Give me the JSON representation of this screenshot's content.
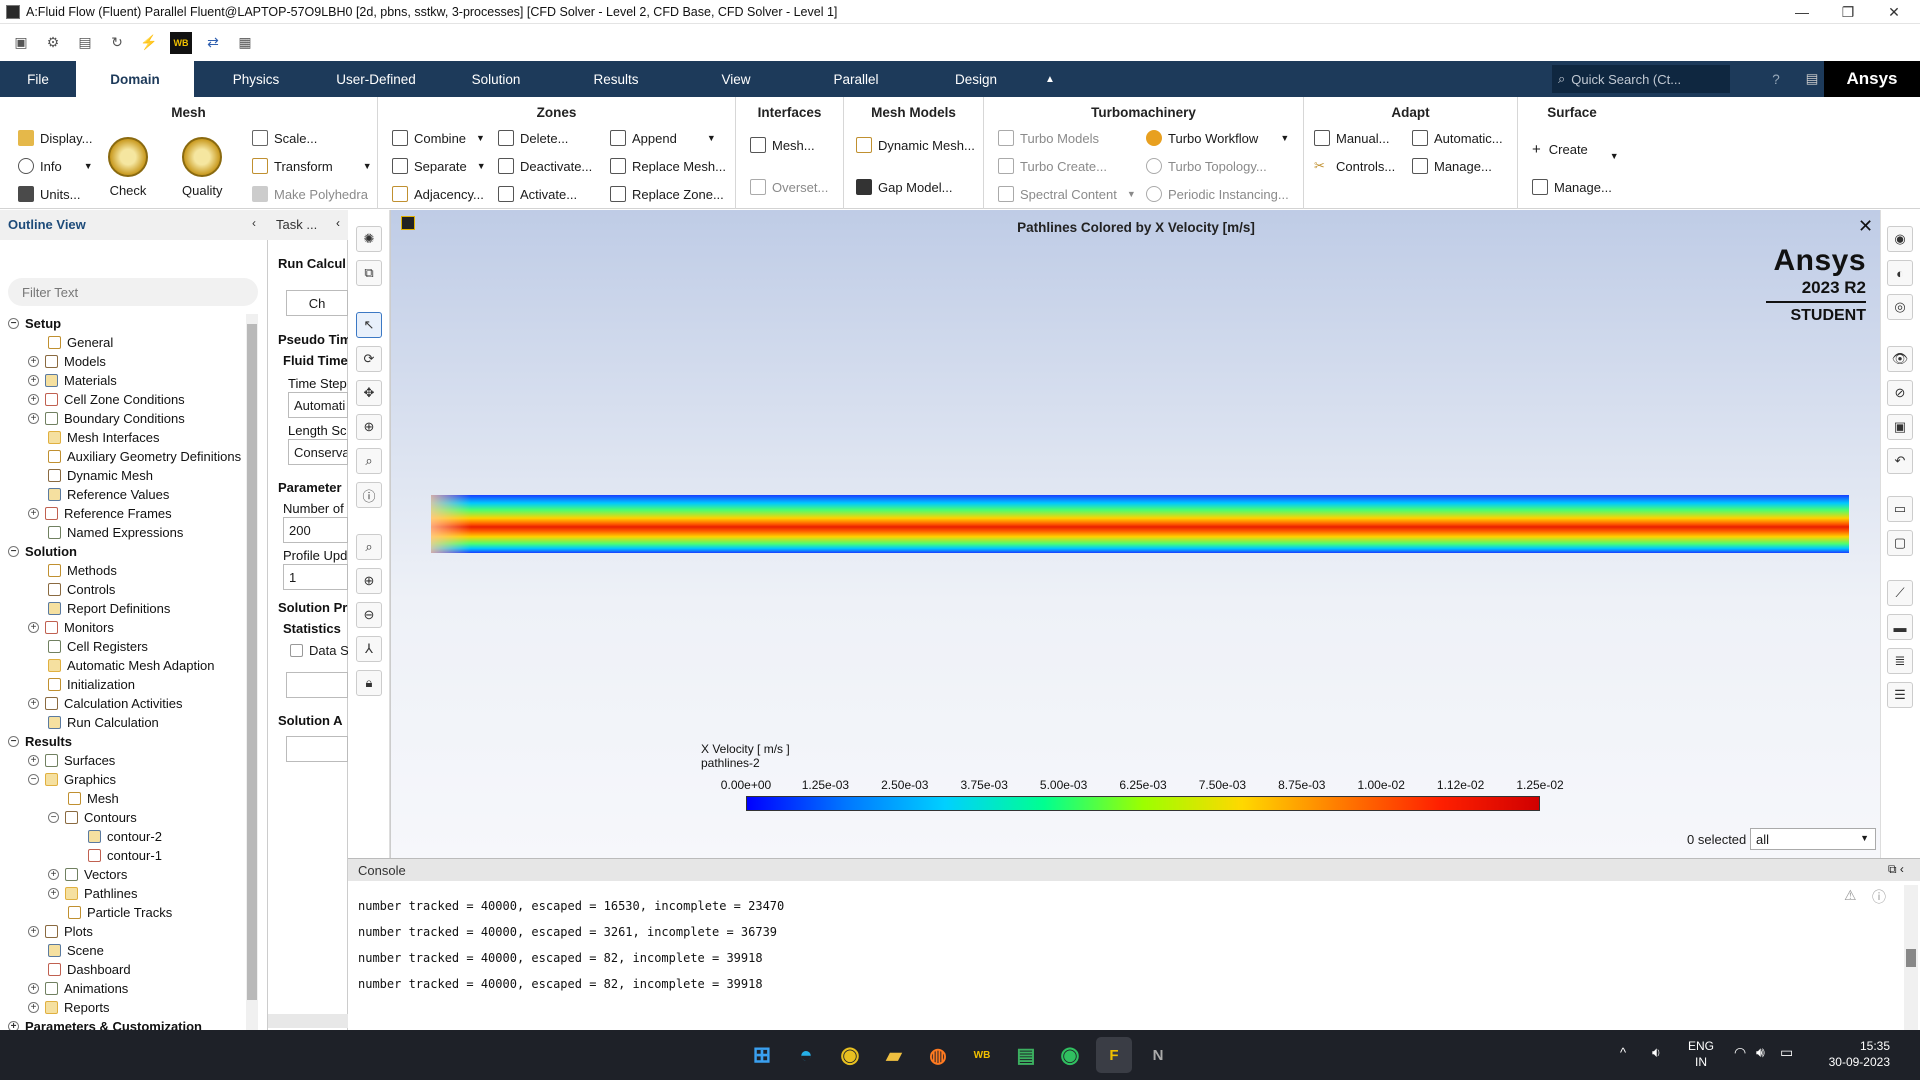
{
  "window": {
    "title": "A:Fluid Flow (Fluent) Parallel Fluent@LAPTOP-57O9LBH0  [2d, pbns, sstkw, 3-processes] [CFD Solver - Level 2, CFD Base, CFD Solver - Level 1]"
  },
  "quick_access": {
    "wb_label": "WB"
  },
  "tabs": [
    "File",
    "Domain",
    "Physics",
    "User-Defined",
    "Solution",
    "Results",
    "View",
    "Parallel",
    "Design"
  ],
  "active_tab": "Domain",
  "search": {
    "placeholder": "Quick Search (Ct..."
  },
  "brand_tab": "Ansys",
  "ribbon": {
    "mesh": {
      "title": "Mesh",
      "display": "Display...",
      "info": "Info",
      "units": "Units...",
      "check": "Check",
      "quality": "Quality",
      "scale": "Scale...",
      "transform": "Transform",
      "make_polyhedra": "Make Polyhedra"
    },
    "zones": {
      "title": "Zones",
      "combine": "Combine",
      "separate": "Separate",
      "adjacency": "Adjacency...",
      "delete": "Delete...",
      "deactivate": "Deactivate...",
      "activate": "Activate...",
      "append": "Append",
      "replace_mesh": "Replace Mesh...",
      "replace_zone": "Replace Zone..."
    },
    "interfaces": {
      "title": "Interfaces",
      "mesh": "Mesh...",
      "overset": "Overset..."
    },
    "mesh_models": {
      "title": "Mesh Models",
      "dynamic_mesh": "Dynamic Mesh...",
      "gap_model": "Gap Model..."
    },
    "turbomachinery": {
      "title": "Turbomachinery",
      "turbo_models": "Turbo Models",
      "turbo_create": "Turbo Create...",
      "spectral_content": "Spectral Content",
      "turbo_workflow": "Turbo Workflow",
      "turbo_topology": "Turbo Topology...",
      "periodic_instancing": "Periodic Instancing..."
    },
    "adapt": {
      "title": "Adapt",
      "manual": "Manual...",
      "controls": "Controls...",
      "automatic": "Automatic...",
      "manage": "Manage..."
    },
    "surface": {
      "title": "Surface",
      "create": "Create",
      "manage": "Manage..."
    }
  },
  "outline": {
    "title": "Outline View",
    "filter_placeholder": "Filter Text",
    "items": [
      {
        "label": "Setup",
        "bold": true,
        "toggle": "−",
        "indent": 0
      },
      {
        "label": "General",
        "indent": 2,
        "toggle": ""
      },
      {
        "label": "Models",
        "indent": 1,
        "toggle": "+"
      },
      {
        "label": "Materials",
        "indent": 1,
        "toggle": "+"
      },
      {
        "label": "Cell Zone Conditions",
        "indent": 1,
        "toggle": "+"
      },
      {
        "label": "Boundary Conditions",
        "indent": 1,
        "toggle": "+"
      },
      {
        "label": "Mesh Interfaces",
        "indent": 2,
        "toggle": ""
      },
      {
        "label": "Auxiliary Geometry Definitions",
        "indent": 2,
        "toggle": ""
      },
      {
        "label": "Dynamic Mesh",
        "indent": 2,
        "toggle": ""
      },
      {
        "label": "Reference Values",
        "indent": 2,
        "toggle": ""
      },
      {
        "label": "Reference Frames",
        "indent": 1,
        "toggle": "+"
      },
      {
        "label": "Named Expressions",
        "indent": 2,
        "toggle": ""
      },
      {
        "label": "Solution",
        "bold": true,
        "toggle": "−",
        "indent": 0
      },
      {
        "label": "Methods",
        "indent": 2,
        "toggle": ""
      },
      {
        "label": "Controls",
        "indent": 2,
        "toggle": ""
      },
      {
        "label": "Report Definitions",
        "indent": 2,
        "toggle": ""
      },
      {
        "label": "Monitors",
        "indent": 1,
        "toggle": "+"
      },
      {
        "label": "Cell Registers",
        "indent": 2,
        "toggle": ""
      },
      {
        "label": "Automatic Mesh Adaption",
        "indent": 2,
        "toggle": ""
      },
      {
        "label": "Initialization",
        "indent": 2,
        "toggle": ""
      },
      {
        "label": "Calculation Activities",
        "indent": 1,
        "toggle": "+"
      },
      {
        "label": "Run Calculation",
        "indent": 2,
        "toggle": ""
      },
      {
        "label": "Results",
        "bold": true,
        "toggle": "−",
        "indent": 0
      },
      {
        "label": "Surfaces",
        "indent": 1,
        "toggle": "+"
      },
      {
        "label": "Graphics",
        "indent": 1,
        "toggle": "−"
      },
      {
        "label": "Mesh",
        "indent": 3,
        "toggle": ""
      },
      {
        "label": "Contours",
        "indent": 2,
        "toggle": "−"
      },
      {
        "label": "contour-2",
        "indent": 4,
        "toggle": ""
      },
      {
        "label": "contour-1",
        "indent": 4,
        "toggle": ""
      },
      {
        "label": "Vectors",
        "indent": 2,
        "toggle": "+"
      },
      {
        "label": "Pathlines",
        "indent": 2,
        "toggle": "+"
      },
      {
        "label": "Particle Tracks",
        "indent": 3,
        "toggle": ""
      },
      {
        "label": "Plots",
        "indent": 1,
        "toggle": "+"
      },
      {
        "label": "Scene",
        "indent": 2,
        "toggle": ""
      },
      {
        "label": "Dashboard",
        "indent": 2,
        "toggle": ""
      },
      {
        "label": "Animations",
        "indent": 1,
        "toggle": "+"
      },
      {
        "label": "Reports",
        "indent": 1,
        "toggle": "+"
      },
      {
        "label": "Parameters & Customization",
        "bold": true,
        "toggle": "+",
        "indent": 0
      },
      {
        "label": "Simulation Reports",
        "bold": true,
        "toggle": "+",
        "indent": 0
      }
    ]
  },
  "task": {
    "title": "Task ...",
    "run_calc": "Run Calcul",
    "check_btn": "Ch",
    "pseudo_time": "Pseudo Tim",
    "fluid_time": "Fluid Time",
    "time_step": "Time Step",
    "time_step_value": "Automati",
    "length_scale": "Length Sc",
    "length_scale_value": "Conserva",
    "parameters": "Parameter",
    "num_iter": "Number of",
    "num_iter_value": "200",
    "profile_update": "Profile Upd",
    "profile_update_value": "1",
    "solution_processing": "Solution Pr",
    "statistics": "Statistics",
    "data_sampling": "Data S",
    "solution_advancement": "Solution A"
  },
  "graphics": {
    "title": "Pathlines Colored by X Velocity [m/s]",
    "brand": "Ansys",
    "release": "2023 R2",
    "edition": "STUDENT",
    "legend_title": "X Velocity [ m/s ]",
    "legend_subtitle": "pathlines-2",
    "ticks": [
      "0.00e+00",
      "1.25e-03",
      "2.50e-03",
      "3.75e-03",
      "5.00e-03",
      "6.25e-03",
      "7.50e-03",
      "8.75e-03",
      "1.00e-02",
      "1.12e-02",
      "1.25e-02"
    ],
    "selected_text": "0 selected",
    "selection_filter": "all"
  },
  "console": {
    "title": "Console",
    "lines": [
      "number tracked = 40000, escaped = 16530, incomplete = 23470",
      "number tracked = 40000, escaped = 3261, incomplete = 36739",
      "number tracked = 40000, escaped = 82, incomplete = 39918",
      "number tracked = 40000, escaped = 82, incomplete = 39918"
    ]
  },
  "taskbar": {
    "lang": "ENG",
    "region": "IN",
    "time": "15:35",
    "date": "30-09-2023"
  },
  "colors": {
    "ribbon_bar": "#1d3a5a",
    "taskbar": "#1e2128",
    "accent": "#3b78c4"
  }
}
